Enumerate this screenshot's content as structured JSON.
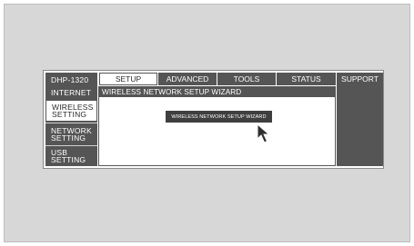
{
  "sidebar": {
    "brand": "DHP-1320",
    "items": [
      {
        "label": "INTERNET"
      },
      {
        "label": "WIRELESS SETTING"
      },
      {
        "label": "NETWORK SETTING"
      },
      {
        "label": "USB SETTING"
      }
    ]
  },
  "tabs": [
    {
      "label": "SETUP"
    },
    {
      "label": "ADVANCED"
    },
    {
      "label": "TOOLS"
    },
    {
      "label": "STATUS"
    }
  ],
  "support": {
    "label": "SUPPORT"
  },
  "content": {
    "heading": "WIRELESS NETWORK SETUP WIZARD",
    "wizard_button": "WIRELESS NETWORK SETUP WIZARD"
  },
  "icons": {
    "cursor": "mouse-pointer-icon"
  },
  "colors": {
    "dark": "#555555",
    "frame": "#d7d7d7",
    "button": "#3f3f3f"
  }
}
